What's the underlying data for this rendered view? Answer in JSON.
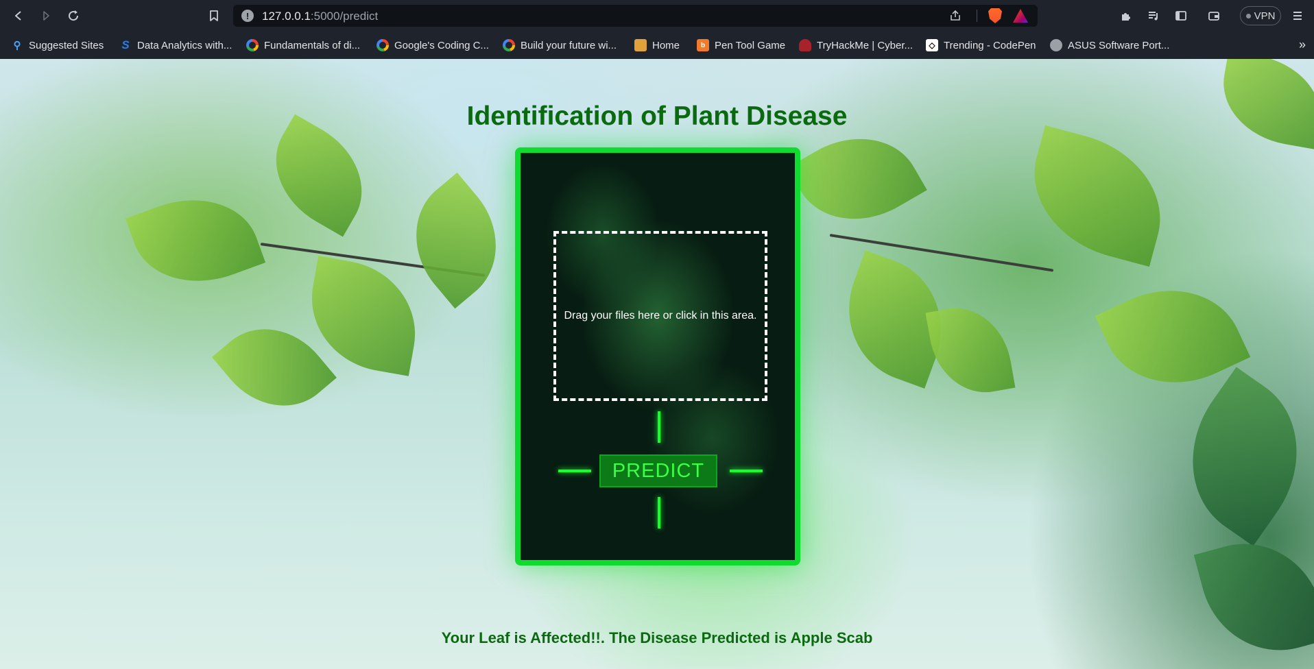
{
  "browser": {
    "url_host": "127.0.0.1",
    "url_path": ":5000/predict",
    "vpn_label": "VPN",
    "icons": [
      "back-icon",
      "forward-icon",
      "reload-icon",
      "bookmark-icon",
      "info-icon",
      "share-icon",
      "brave-shields-icon",
      "brave-rewards-icon",
      "extensions-icon",
      "playlist-icon",
      "sidebar-icon",
      "wallet-icon",
      "menu-icon"
    ]
  },
  "bookmarks": {
    "items": [
      {
        "label": "Suggested Sites",
        "icon": "search-icon"
      },
      {
        "label": "Data Analytics with...",
        "icon": "s-logo-icon"
      },
      {
        "label": "Fundamentals of di...",
        "icon": "google-icon"
      },
      {
        "label": "Google's Coding C...",
        "icon": "google-icon"
      },
      {
        "label": "Build your future wi...",
        "icon": "google-icon"
      },
      {
        "label": "Home",
        "icon": "box-icon"
      },
      {
        "label": "Pen Tool Game",
        "icon": "bezier-icon"
      },
      {
        "label": "TryHackMe | Cyber...",
        "icon": "tryhackme-icon"
      },
      {
        "label": "Trending - CodePen",
        "icon": "codepen-icon"
      },
      {
        "label": "ASUS Software Port...",
        "icon": "globe-icon"
      }
    ],
    "more": "»"
  },
  "page": {
    "title": "Identification of Plant Disease",
    "dropzone_text": "Drag your files here or click in this area.",
    "predict_label": "PREDICT",
    "result_text": "Your Leaf is Affected!!. The Disease Predicted is Apple Scab",
    "accent_color": "#0fdc2e",
    "title_color": "#0b6a10"
  }
}
